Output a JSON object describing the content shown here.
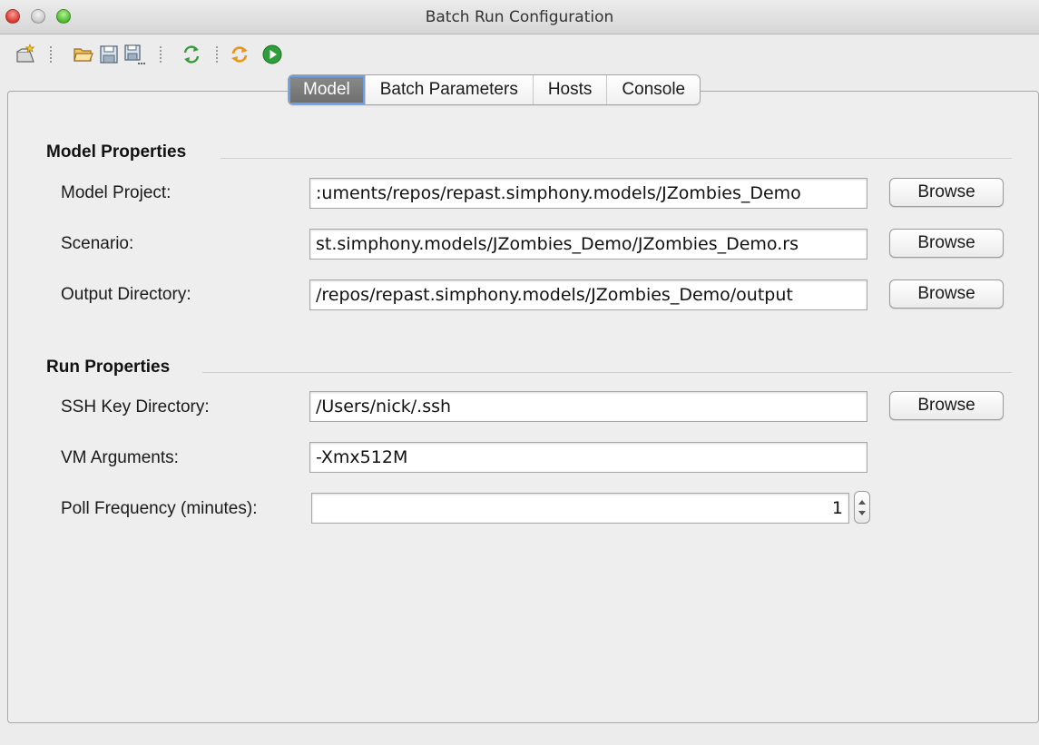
{
  "window": {
    "title": "Batch Run Configuration"
  },
  "toolbar": {
    "icons": [
      "new-icon",
      "open-folder-icon",
      "save-icon",
      "save-as-icon",
      "refresh-icon",
      "sync-icon",
      "run-icon"
    ]
  },
  "tabs": [
    {
      "label": "Model",
      "active": true
    },
    {
      "label": "Batch Parameters",
      "active": false
    },
    {
      "label": "Hosts",
      "active": false
    },
    {
      "label": "Console",
      "active": false
    }
  ],
  "model_properties": {
    "title": "Model Properties",
    "model_project": {
      "label": "Model Project:",
      "value": ":uments/repos/repast.simphony.models/JZombies_Demo",
      "button": "Browse"
    },
    "scenario": {
      "label": "Scenario:",
      "value": "st.simphony.models/JZombies_Demo/JZombies_Demo.rs",
      "button": "Browse"
    },
    "output_directory": {
      "label": "Output Directory:",
      "value": "/repos/repast.simphony.models/JZombies_Demo/output",
      "button": "Browse"
    }
  },
  "run_properties": {
    "title": "Run Properties",
    "ssh_key_directory": {
      "label": "SSH Key Directory:",
      "value": "/Users/nick/.ssh",
      "button": "Browse"
    },
    "vm_arguments": {
      "label": "VM Arguments:",
      "value": "-Xmx512M"
    },
    "poll_frequency": {
      "label": "Poll Frequency (minutes):",
      "value": "1"
    }
  },
  "colors": {
    "run_green": "#2e9e3a",
    "folder_orange": "#e8a33a",
    "active_tab": "#7a7a7a",
    "focus_ring": "#6aa0e8"
  }
}
